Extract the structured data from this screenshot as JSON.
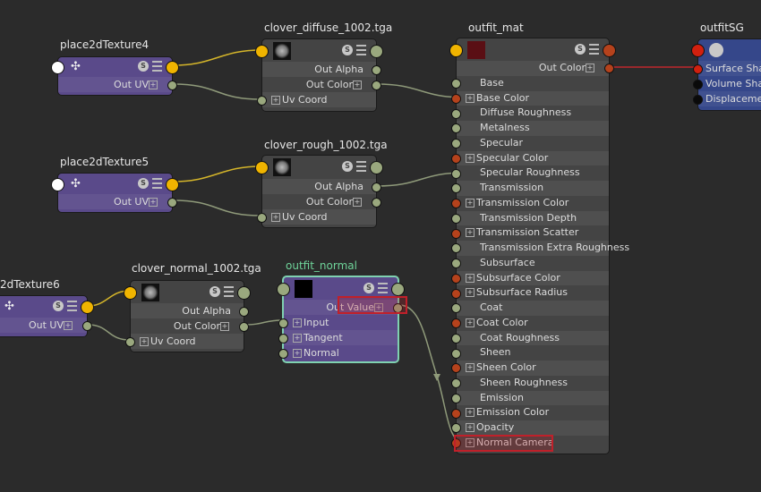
{
  "editor": "Hypershade node editor",
  "port_colors": {
    "float": "#9aa87e",
    "color_connected": "#b5421c",
    "input_main": "#f0b400",
    "message": "#ffffff",
    "sg_connected": "#d1200f",
    "sg_empty": "#0a0a0a"
  },
  "nodes": {
    "place2dTexture4": {
      "title": "place2dTexture4",
      "rows": [
        {
          "label": "Out UV"
        }
      ]
    },
    "clover_diffuse": {
      "title": "clover_diffuse_1002.tga",
      "rows": [
        {
          "label": "Out Alpha"
        },
        {
          "label": "Out Color"
        },
        {
          "label": "Uv Coord"
        }
      ]
    },
    "place2dTexture5": {
      "title": "place2dTexture5",
      "rows": [
        {
          "label": "Out UV"
        }
      ]
    },
    "clover_rough": {
      "title": "clover_rough_1002.tga",
      "rows": [
        {
          "label": "Out Alpha"
        },
        {
          "label": "Out Color"
        },
        {
          "label": "Uv Coord"
        }
      ]
    },
    "place2dTexture6": {
      "title": "2dTexture6",
      "rows": [
        {
          "label": "Out UV"
        }
      ]
    },
    "clover_normal": {
      "title": "clover_normal_1002.tga",
      "rows": [
        {
          "label": "Out Alpha"
        },
        {
          "label": "Out Color"
        },
        {
          "label": "Uv Coord"
        }
      ]
    },
    "outfit_normal": {
      "title": "outfit_normal",
      "rows": [
        {
          "label": "Out Value"
        },
        {
          "label": "Input"
        },
        {
          "label": "Tangent"
        },
        {
          "label": "Normal"
        }
      ]
    },
    "outfit_mat": {
      "title": "outfit_mat",
      "rows": [
        {
          "label": "Out Color"
        },
        {
          "label": "Base"
        },
        {
          "label": "Base Color"
        },
        {
          "label": "Diffuse Roughness"
        },
        {
          "label": "Metalness"
        },
        {
          "label": "Specular"
        },
        {
          "label": "Specular Color"
        },
        {
          "label": "Specular Roughness"
        },
        {
          "label": "Transmission"
        },
        {
          "label": "Transmission Color"
        },
        {
          "label": "Transmission Depth"
        },
        {
          "label": "Transmission Scatter"
        },
        {
          "label": "Transmission Extra Roughness"
        },
        {
          "label": "Subsurface"
        },
        {
          "label": "Subsurface Color"
        },
        {
          "label": "Subsurface Radius"
        },
        {
          "label": "Coat"
        },
        {
          "label": "Coat Color"
        },
        {
          "label": "Coat Roughness"
        },
        {
          "label": "Sheen"
        },
        {
          "label": "Sheen Color"
        },
        {
          "label": "Sheen Roughness"
        },
        {
          "label": "Emission"
        },
        {
          "label": "Emission Color"
        },
        {
          "label": "Opacity"
        },
        {
          "label": "Normal Camera"
        }
      ]
    },
    "outfitSG": {
      "title": "outfitSG",
      "rows": [
        {
          "label": "Surface Shader"
        },
        {
          "label": "Volume Shader"
        },
        {
          "label": "Displacement"
        }
      ]
    }
  },
  "swatch_label": "S"
}
